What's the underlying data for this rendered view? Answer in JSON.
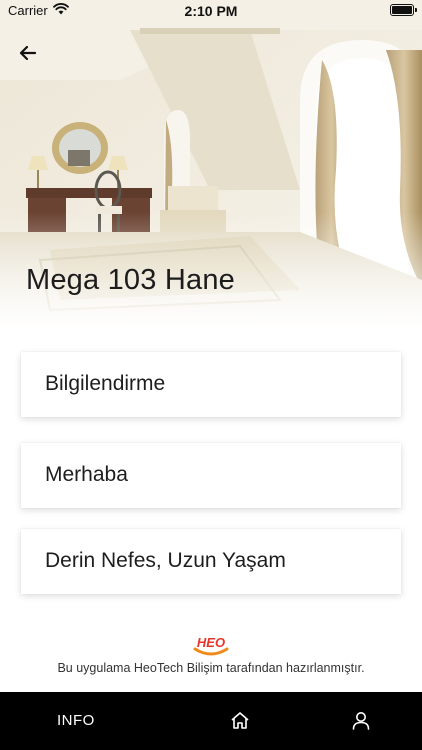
{
  "status_bar": {
    "carrier": "Carrier",
    "time": "2:10 PM",
    "icons": [
      "wifi-icon",
      "battery-icon"
    ]
  },
  "hero": {
    "title": "Mega 103 Hane",
    "back_icon": "back-arrow-icon"
  },
  "cards": [
    {
      "label": "Bilgilendirme"
    },
    {
      "label": "Merhaba"
    },
    {
      "label": "Derin Nefes, Uzun Yaşam"
    }
  ],
  "footer": {
    "logo_text": "HEO",
    "credit": "Bu uygulama HeoTech Bilişim tarafından hazırlanmıştır."
  },
  "tab_bar": {
    "info_label": "INFO",
    "icons": [
      "home-icon",
      "user-icon"
    ]
  },
  "colors": {
    "tab_bar_bg": "#000000",
    "logo_orange": "#f08a1c",
    "logo_red": "#e8352b"
  }
}
